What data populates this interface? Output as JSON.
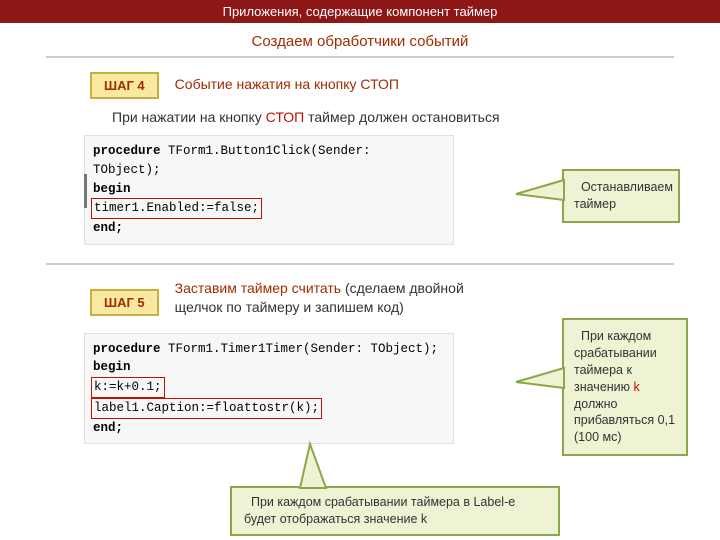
{
  "banner": "Приложения, содержащие компонент таймер",
  "subtitle": "Создаем обработчики событий",
  "step4": {
    "tag": "ШАГ 4",
    "title": "Событие нажатия на кнопку СТОП",
    "body_pre": "При нажатии на кнопку ",
    "body_red": "СТОП",
    "body_post": " таймер должен остановиться",
    "code": {
      "l1a": "procedure",
      "l1b": " TForm1.Button1Click(Sender: TObject);",
      "l2": "begin",
      "l3": "timer1.Enabled:=false;",
      "l4": "end;"
    },
    "callout": "Останавливаем таймер"
  },
  "step5": {
    "tag": "ШАГ 5",
    "title_red": "Заставим таймер считать",
    "title_rest": " (сделаем двойной щелчок по таймеру и запишем код)",
    "code": {
      "l1a": "procedure",
      "l1b": " TForm1.Timer1Timer(Sender: TObject);",
      "l2": "begin",
      "l3": "k:=k+0.1;",
      "l4": "label1.Caption:=floattostr(k);",
      "l5": "end;"
    },
    "callout_right_pre": "При каждом срабатывании таймера к значению ",
    "callout_right_k": "k",
    "callout_right_post": " должно прибавляться 0,1 (100 мс)",
    "callout_bottom_pre": "При каждом срабатывании таймера в ",
    "callout_bottom_label": "Label",
    "callout_bottom_mid": "-е будет отображаться значение ",
    "callout_bottom_k": "k"
  }
}
